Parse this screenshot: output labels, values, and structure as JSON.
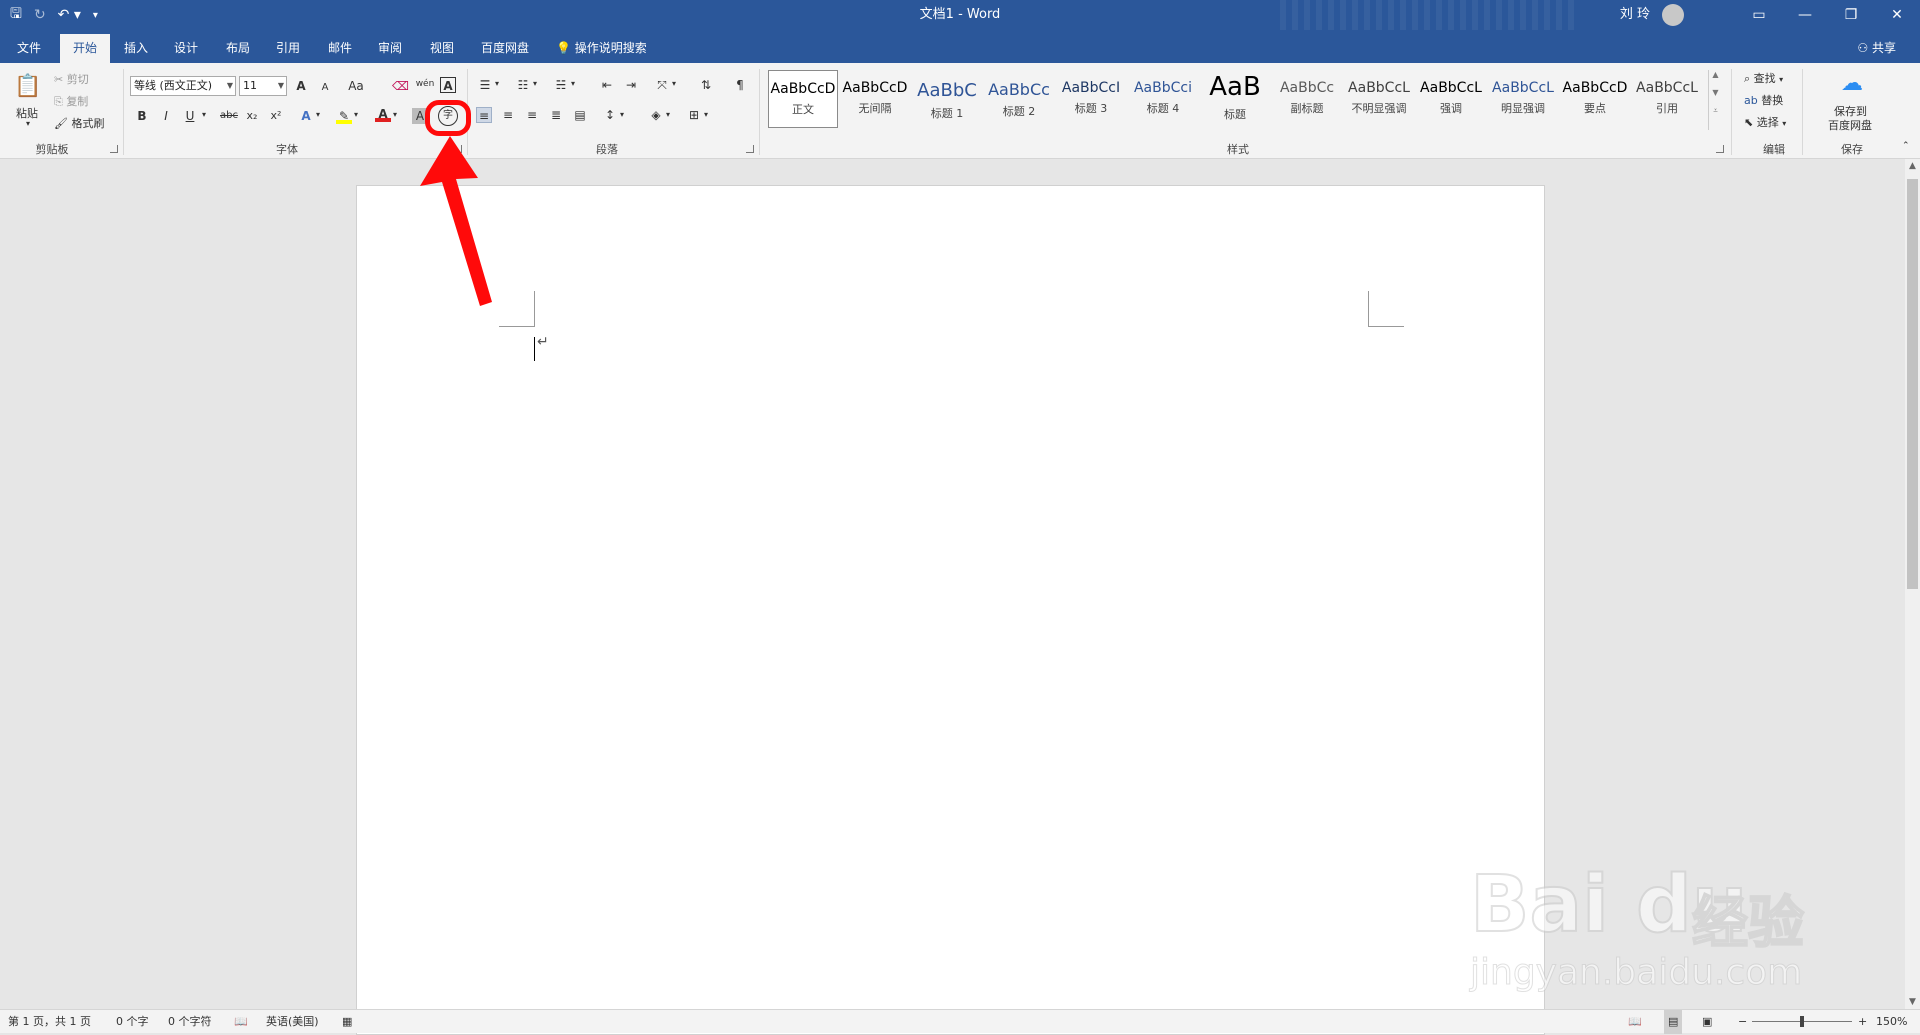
{
  "window": {
    "title": "文档1  -  Word",
    "user": "刘 玲",
    "controls": [
      "minimize-icon",
      "restore-icon",
      "close-icon"
    ]
  },
  "tabs": [
    {
      "label": "文件",
      "active": false
    },
    {
      "label": "开始",
      "active": true
    },
    {
      "label": "插入",
      "active": false
    },
    {
      "label": "设计",
      "active": false
    },
    {
      "label": "布局",
      "active": false
    },
    {
      "label": "引用",
      "active": false
    },
    {
      "label": "邮件",
      "active": false
    },
    {
      "label": "审阅",
      "active": false
    },
    {
      "label": "视图",
      "active": false
    },
    {
      "label": "百度网盘",
      "active": false
    }
  ],
  "tell_me": "操作说明搜索",
  "share": "共享",
  "clipboard": {
    "paste": "粘贴",
    "cut": "剪切",
    "copy": "复制",
    "format_painter": "格式刷",
    "group": "剪贴板"
  },
  "font": {
    "font_name": "等线 (西文正文)",
    "font_size": "11",
    "group": "字体",
    "grow": "A",
    "shrink": "A",
    "change_case": "Aa",
    "phonetic": "wén",
    "bold": "B",
    "italic": "I",
    "underline": "U",
    "strike": "abc",
    "subscript": "x₂",
    "superscript": "x²",
    "text_effect": "A",
    "font_color": "A",
    "char_shading": "A",
    "enclose": "字"
  },
  "paragraph": {
    "group": "段落"
  },
  "styles": {
    "group": "样式",
    "items": [
      {
        "sample": "AaBbCcD",
        "name": "正文",
        "color": "#000000",
        "size": 14,
        "selected": true
      },
      {
        "sample": "AaBbCcD",
        "name": "无间隔",
        "color": "#000000",
        "size": 14,
        "selected": false
      },
      {
        "sample": "AaBbC",
        "name": "标题 1",
        "color": "#2f5496",
        "size": 18,
        "selected": false
      },
      {
        "sample": "AaBbCc",
        "name": "标题 2",
        "color": "#2f5496",
        "size": 16,
        "selected": false
      },
      {
        "sample": "AaBbCcI",
        "name": "标题 3",
        "color": "#1f3864",
        "size": 14,
        "selected": false
      },
      {
        "sample": "AaBbCci",
        "name": "标题 4",
        "color": "#2f5496",
        "size": 14,
        "selected": false
      },
      {
        "sample": "AaB",
        "name": "标题",
        "color": "#000000",
        "size": 26,
        "selected": false
      },
      {
        "sample": "AaBbCc",
        "name": "副标题",
        "color": "#5a5a5a",
        "size": 14,
        "selected": false
      },
      {
        "sample": "AaBbCcL",
        "name": "不明显强调",
        "color": "#404040",
        "size": 14,
        "selected": false
      },
      {
        "sample": "AaBbCcL",
        "name": "强调",
        "color": "#000000",
        "size": 14,
        "selected": false
      },
      {
        "sample": "AaBbCcL",
        "name": "明显强调",
        "color": "#2f5496",
        "size": 14,
        "selected": false
      },
      {
        "sample": "AaBbCcD",
        "name": "要点",
        "color": "#000000",
        "size": 14,
        "selected": false
      },
      {
        "sample": "AaBbCcL",
        "name": "引用",
        "color": "#404040",
        "size": 14,
        "selected": false
      }
    ]
  },
  "editing": {
    "find": "查找",
    "replace": "替换",
    "select": "选择",
    "group": "编辑"
  },
  "save_group": {
    "save_label_1": "保存到",
    "save_label_2": "百度网盘",
    "group": "保存"
  },
  "document": {
    "paragraph_mark": "↵"
  },
  "status": {
    "page": "第 1 页，共 1 页",
    "words": "0 个字",
    "chars": "0 个字符",
    "language": "英语(美国)",
    "zoom": "150%",
    "zoom_fraction": 0.5
  },
  "watermark": {
    "brand": "Bai du",
    "cn": "经验",
    "url": "jingyan.baidu.com"
  },
  "colors": {
    "accent": "#2b579a",
    "highlight": "#ff0a0a"
  }
}
